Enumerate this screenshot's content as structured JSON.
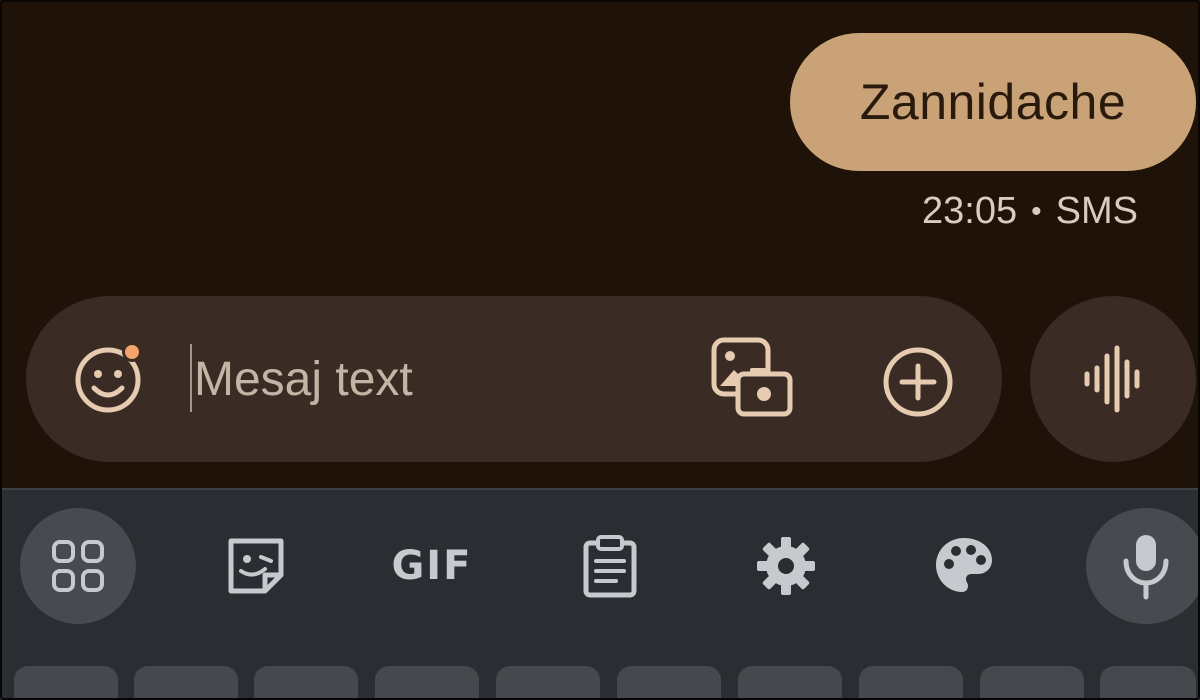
{
  "conversation": {
    "message_text": "Zannidache",
    "timestamp": "23:05",
    "separator": "•",
    "channel": "SMS"
  },
  "compose": {
    "placeholder": "Mesaj text",
    "emoji_icon": "smiley-icon",
    "gallery_icon": "gallery-icon",
    "add_icon": "add-circle-icon",
    "voice_icon": "voice-waveform-icon"
  },
  "keyboard_toolbar": {
    "items": [
      {
        "icon": "apps-grid-icon"
      },
      {
        "icon": "sticker-icon"
      },
      {
        "label": "GIF"
      },
      {
        "icon": "clipboard-icon"
      },
      {
        "icon": "settings-gear-icon"
      },
      {
        "icon": "theme-palette-icon"
      },
      {
        "icon": "microphone-icon"
      }
    ],
    "gif_label": "GIF"
  },
  "colors": {
    "background": "#1f1209",
    "bubble": "#c9a377",
    "compose_bg": "#3a2c24",
    "accent_dot": "#f2a46a",
    "keyboard_bg": "#2a2d31"
  }
}
